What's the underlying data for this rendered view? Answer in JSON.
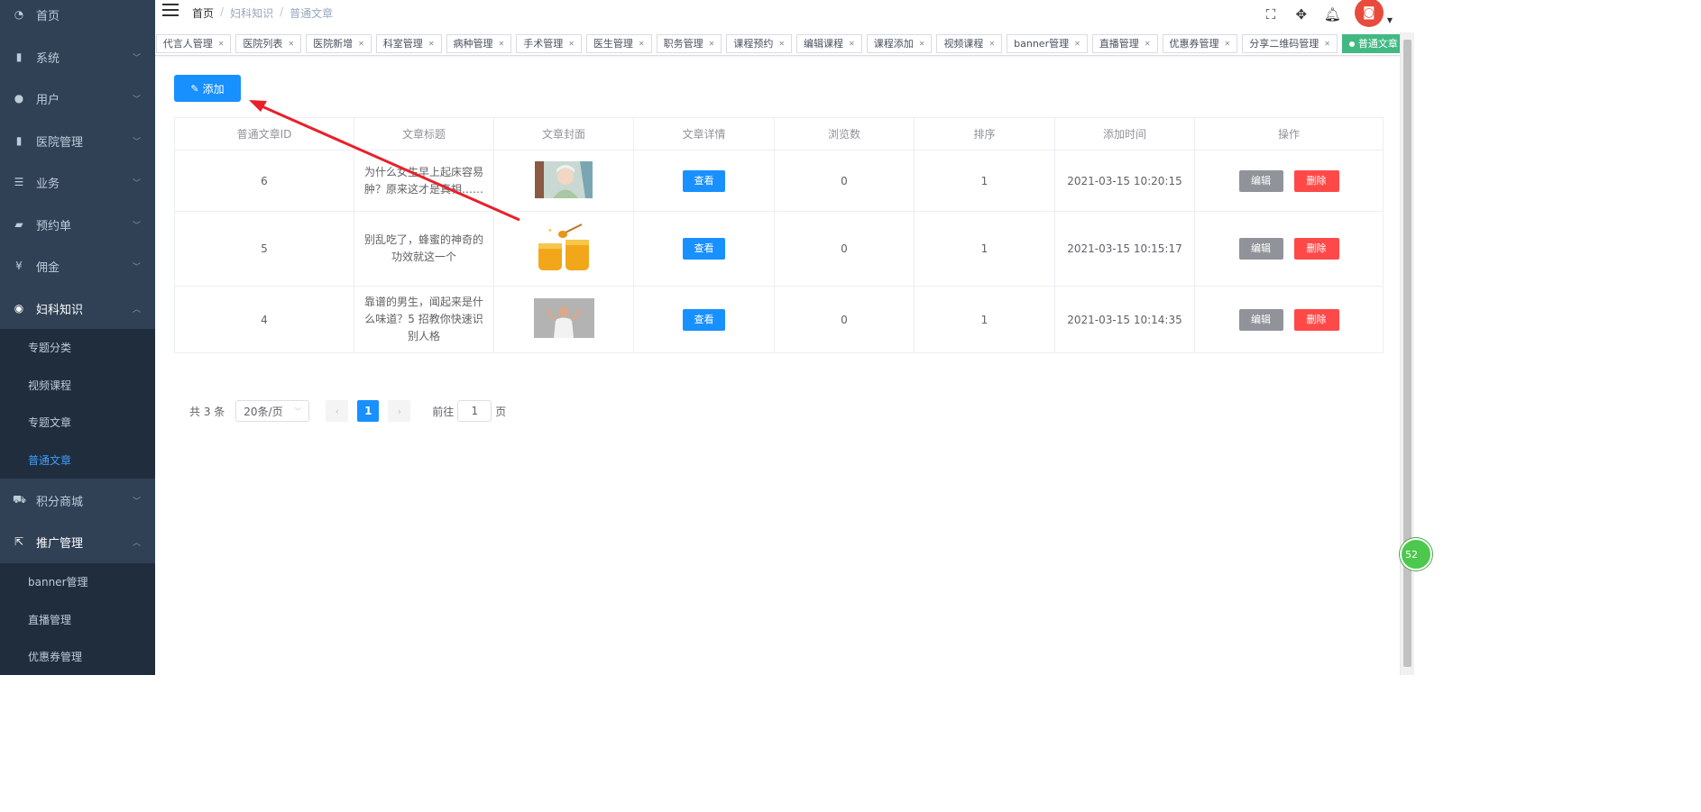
{
  "sidebar": {
    "items": [
      {
        "label": "首页",
        "icon": "dashboard-icon"
      },
      {
        "label": "系统",
        "icon": "bar-chart-icon"
      },
      {
        "label": "用户",
        "icon": "user-icon"
      },
      {
        "label": "医院管理",
        "icon": "bar-chart-icon"
      },
      {
        "label": "业务",
        "icon": "list-icon"
      },
      {
        "label": "预约单",
        "icon": "chat-icon"
      },
      {
        "label": "佣金",
        "icon": "yen-icon"
      },
      {
        "label": "妇科知识",
        "icon": "globe-icon"
      },
      {
        "label": "积分商城",
        "icon": "cart-icon"
      },
      {
        "label": "推广管理",
        "icon": "external-link-icon"
      }
    ],
    "knowledge_sub": [
      "专题分类",
      "视频课程",
      "专题文章",
      "普通文章"
    ],
    "promo_sub": [
      "banner管理",
      "直播管理",
      "优惠券管理"
    ]
  },
  "breadcrumb": [
    "首页",
    "妇科知识",
    "普通文章"
  ],
  "tags": [
    "代言人管理",
    "医院列表",
    "医院新增",
    "科室管理",
    "病种管理",
    "手术管理",
    "医生管理",
    "职务管理",
    "课程预约",
    "编辑课程",
    "课程添加",
    "视频课程",
    "banner管理",
    "直播管理",
    "优惠券管理",
    "分享二维码管理",
    "普通文章"
  ],
  "toolbar": {
    "add_label": "添加"
  },
  "table": {
    "headers": [
      "普通文章ID",
      "文章标题",
      "文章封面",
      "文章详情",
      "浏览数",
      "排序",
      "添加时间",
      "操作"
    ],
    "rows": [
      {
        "id": "6",
        "title": "为什么女生早上起床容易肿？原来这才是真相……",
        "view": "查看",
        "views": "0",
        "sort": "1",
        "time": "2021-03-15 10:20:15",
        "edit": "编辑",
        "del": "删除"
      },
      {
        "id": "5",
        "title": "别乱吃了，蜂蜜的神奇的功效就这一个",
        "view": "查看",
        "views": "0",
        "sort": "1",
        "time": "2021-03-15 10:15:17",
        "edit": "编辑",
        "del": "删除"
      },
      {
        "id": "4",
        "title": "靠谱的男生，闻起来是什么味道？5 招教你快速识别人格",
        "view": "查看",
        "views": "0",
        "sort": "1",
        "time": "2021-03-15 10:14:35",
        "edit": "编辑",
        "del": "删除"
      }
    ]
  },
  "pagination": {
    "total": "共 3 条",
    "page_size": "20条/页",
    "current": "1",
    "goto": "前往",
    "goto_value": "1",
    "page_unit": "页"
  },
  "float_badge": "52",
  "colors": {
    "sidebar_bg": "#304156",
    "accent": "#1890ff",
    "active_tag": "#42b983",
    "danger": "#ff4949",
    "annotation": "#e8202a"
  }
}
